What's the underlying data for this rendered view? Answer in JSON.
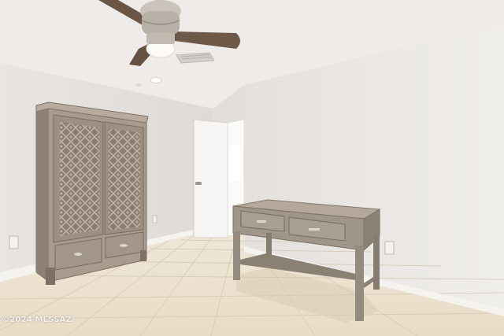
{
  "watermark": "©2024 MLSSAZ",
  "colors": {
    "ceiling": "#eeeae7",
    "left_wall": "#e6e2df",
    "right_wall": "#ece9e6",
    "floor_tile": "#ece3d3",
    "grout": "#d9cfbe",
    "baseboard": "#f4f2ef",
    "wood": "#a69a8c",
    "wood_dark": "#7f7366",
    "door": "#f6f5f3",
    "fan_blade": "#6a5545",
    "fan_metal": "#c9c3bb"
  }
}
